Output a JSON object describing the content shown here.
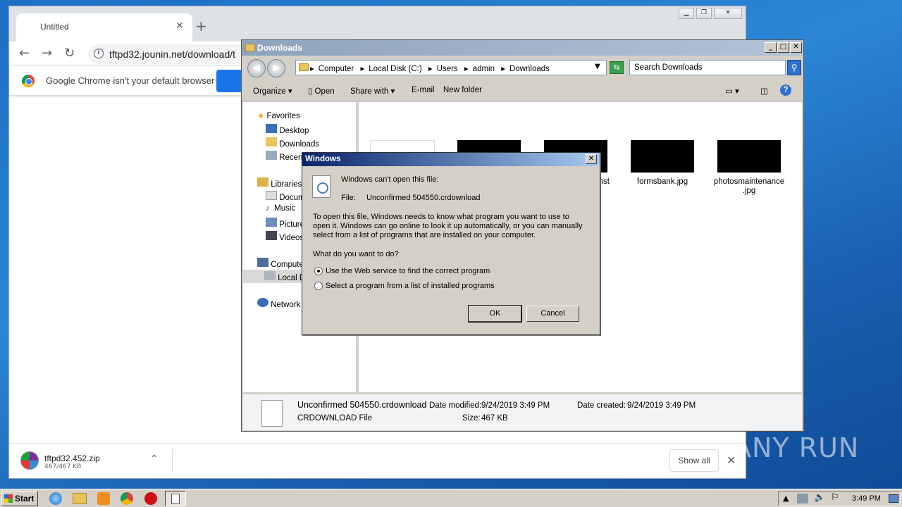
{
  "chrome": {
    "tab_title": "Untitled",
    "url": "tftpd32.jounin.net/download/t",
    "infobar_text": "Google Chrome isn't your default browser",
    "download": {
      "name": "tftpd32.452.zip",
      "size": "467/467 KB"
    },
    "show_all": "Show all"
  },
  "explorer": {
    "title": "Downloads",
    "breadcrumbs": [
      "Computer",
      "Local Disk (C:)",
      "Users",
      "admin",
      "Downloads"
    ],
    "search_placeholder": "Search Downloads",
    "commands": {
      "organize": "Organize",
      "open": "Open",
      "share": "Share with",
      "email": "E-mail",
      "new_folder": "New folder"
    },
    "nav": {
      "favorites": "Favorites",
      "desktop": "Desktop",
      "downloads": "Downloads",
      "recent": "Recen",
      "libraries": "Libraries",
      "documents": "Docum",
      "music": "Music",
      "pictures": "Picture",
      "videos": "Videos",
      "computer": "Compute",
      "local_disk": "Local D",
      "network": "Network"
    },
    "files": [
      {
        "label": "nst"
      },
      {
        "label": "formsbank.jpg"
      },
      {
        "label": "photosmaintenance\n.jpg"
      }
    ],
    "details": {
      "name": "Unconfirmed 504550.crdownload",
      "type": "CRDOWNLOAD File",
      "modified_label": "Date modified:",
      "modified_value": "9/24/2019 3:49 PM",
      "created_label": "Date created:",
      "created_value": "9/24/2019 3:49 PM",
      "size_label": "Size:",
      "size_value": "467 KB"
    }
  },
  "dialog": {
    "title": "Windows",
    "heading": "Windows can't open this file:",
    "file_label": "File:",
    "file_name": "Unconfirmed 504550.crdownload",
    "body_line1": "To open this file, Windows needs to know what program you want to use to",
    "body_line2": "open it. Windows can go online to look it up automatically, or you can manually",
    "body_line3": "select from a list of programs that are installed on your computer.",
    "question": "What do you want to do?",
    "option1": "Use the Web service to find the correct program",
    "option2": "Select a program from a list of installed programs",
    "ok": "OK",
    "cancel": "Cancel"
  },
  "taskbar": {
    "start": "Start",
    "clock": "3:49 PM"
  },
  "watermark": "ANY RUN"
}
